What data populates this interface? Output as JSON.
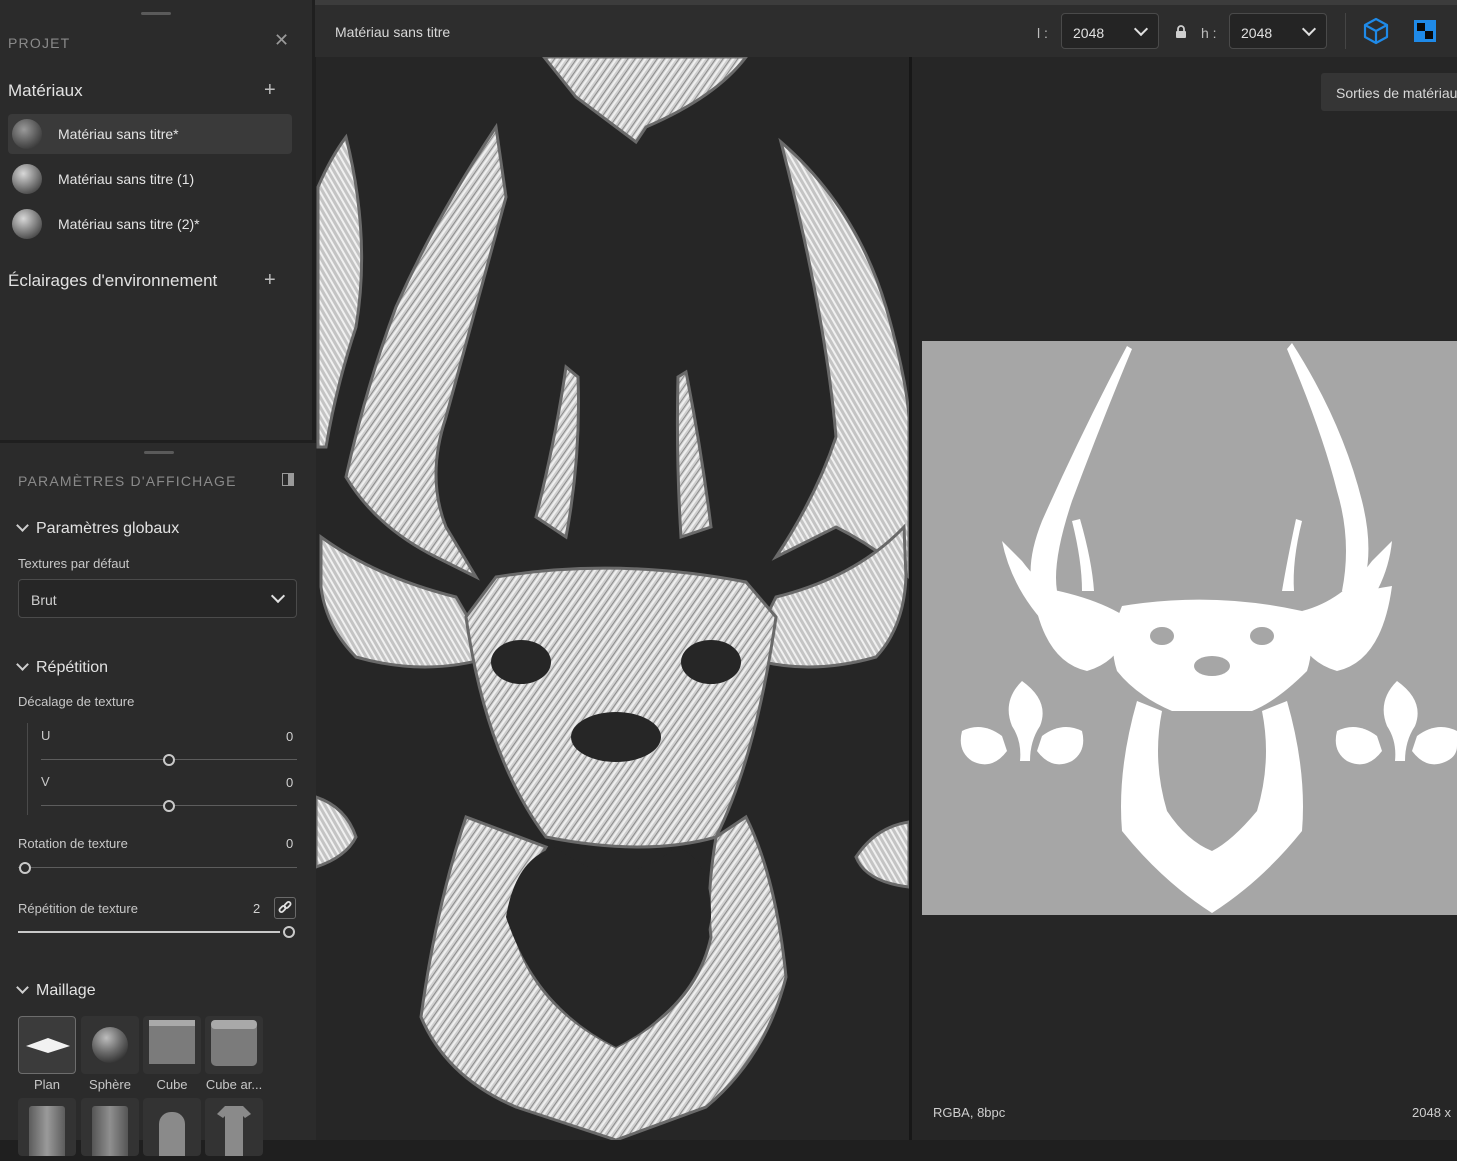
{
  "project": {
    "title": "PROJET",
    "materials_header": "Matériaux",
    "materials": [
      {
        "label": "Matériau sans titre*",
        "selected": true
      },
      {
        "label": "Matériau sans titre (1)",
        "selected": false
      },
      {
        "label": "Matériau sans titre (2)*",
        "selected": false
      }
    ],
    "lighting_header": "Éclairages d'environnement"
  },
  "display": {
    "title": "PARAMÈTRES D'AFFICHAGE",
    "global": {
      "header": "Paramètres globaux",
      "default_textures_label": "Textures par défaut",
      "default_textures_value": "Brut"
    },
    "repetition": {
      "header": "Répétition",
      "offset_label": "Décalage de texture",
      "u_label": "U",
      "u_value": "0",
      "v_label": "V",
      "v_value": "0",
      "rotation_label": "Rotation de texture",
      "rotation_value": "0",
      "tiling_label": "Répétition de texture",
      "tiling_value": "2"
    },
    "mesh": {
      "header": "Maillage",
      "shapes": [
        "Plan",
        "Sphère",
        "Cube",
        "Cube ar..."
      ]
    }
  },
  "topbar": {
    "material_name": "Matériau sans titre",
    "width_label": "l :",
    "width_value": "2048",
    "height_label": "h :",
    "height_value": "2048"
  },
  "viewport2d": {
    "outputs_button": "Sorties de matériau",
    "format": "RGBA, 8bpc",
    "size": "2048 x"
  },
  "colors": {
    "accent": "#1f8ae8",
    "panel": "#2b2b2b",
    "viewport": "#262626",
    "texture_bg": "#a6a6a6"
  }
}
